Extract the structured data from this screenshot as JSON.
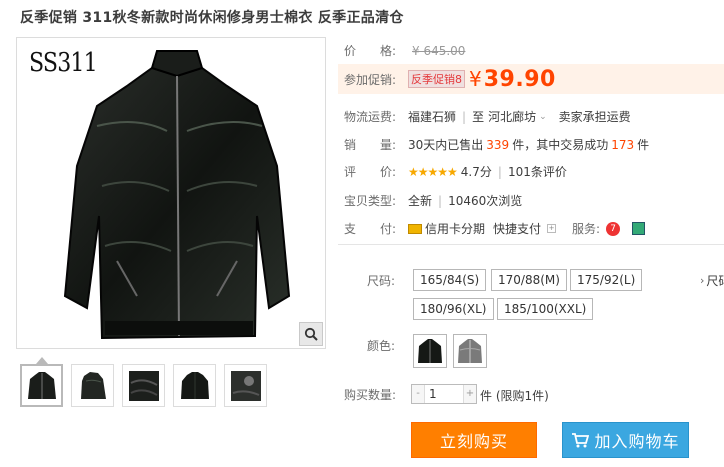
{
  "title": "反季促销 311秋冬新款时尚休闲修身男士棉衣 反季正品清仓",
  "gallery": {
    "brand_logo": "SS311",
    "thumbnail_count": 5
  },
  "price": {
    "label": "价　　格:",
    "original": "¥ 645.00"
  },
  "promo": {
    "label": "参加促销:",
    "tag": "反季促销8",
    "currency": "¥",
    "price": "39.90"
  },
  "shipping": {
    "label": "物流运费:",
    "from": "福建石狮",
    "to": "河北廊坊",
    "fee": "卖家承担运费"
  },
  "sales": {
    "label": "销　　量:",
    "prefix": "30天内已售出",
    "sold": "339",
    "mid": "件，其中交易成功",
    "success": "173",
    "suffix": "件"
  },
  "rating": {
    "label": "评　　价:",
    "stars": "★★★★★",
    "score": "4.7分",
    "reviews": "101条评价"
  },
  "type": {
    "label": "宝贝类型:",
    "condition": "全新",
    "views": "10460次浏览"
  },
  "payment": {
    "label": "支　　付:",
    "credit": "信用卡分期",
    "quick": "快捷支付",
    "service_label": "服务:"
  },
  "size": {
    "label": "尺码:",
    "options": [
      "165/84(S)",
      "170/88(M)",
      "175/92(L)",
      "180/96(XL)",
      "185/100(XXL)"
    ],
    "overflow": "尺码"
  },
  "color": {
    "label": "颜色:",
    "options": [
      "黑色",
      "灰色"
    ]
  },
  "quantity": {
    "label": "购买数量:",
    "value": "1",
    "minus": "-",
    "plus": "+",
    "limit": "件 (限购1件)"
  },
  "actions": {
    "buy": "立刻购买",
    "cart": "加入购物车"
  },
  "colors": {
    "accent": "#ff4400",
    "buy": "#ff7f00",
    "cart": "#3ba7e0",
    "star": "#f7a800"
  }
}
